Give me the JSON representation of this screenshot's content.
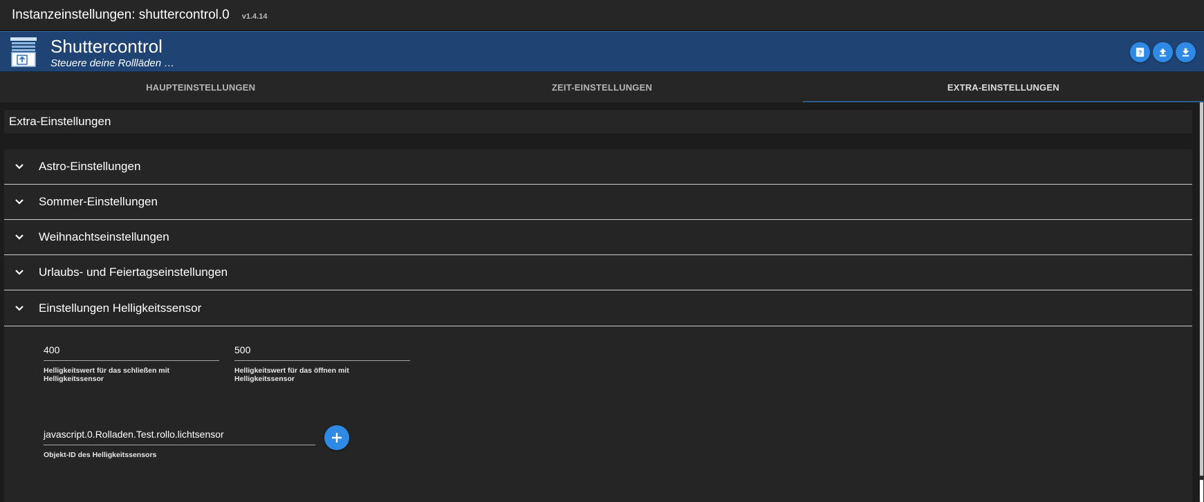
{
  "window": {
    "title": "Instanzeinstellungen: shuttercontrol.0",
    "version": "v1.4.14"
  },
  "header": {
    "app_name": "Shuttercontrol",
    "app_desc": "Steuere deine Rollläden …",
    "buttons": [
      "help-icon",
      "upload-icon",
      "download-icon"
    ],
    "accent": "#1f4474"
  },
  "tabs": [
    {
      "label": "HAUPTEINSTELLUNGEN",
      "active": false
    },
    {
      "label": "ZEIT-EINSTELLUNGEN",
      "active": false
    },
    {
      "label": "EXTRA-EINSTELLUNGEN",
      "active": true
    }
  ],
  "section": {
    "title": "Extra-Einstellungen"
  },
  "accordion": [
    {
      "label": "Astro-Einstellungen",
      "expanded": false
    },
    {
      "label": "Sommer-Einstellungen",
      "expanded": false
    },
    {
      "label": "Weihnachtseinstellungen",
      "expanded": false
    },
    {
      "label": "Urlaubs- und Feiertagseinstellungen",
      "expanded": false
    },
    {
      "label": "Einstellungen Helligkeitssensor",
      "expanded": true
    }
  ],
  "brightness": {
    "close_value": "400",
    "close_hint": "Helligkeitswert für das schließen mit Helligkeitssensor",
    "open_value": "500",
    "open_hint": "Helligkeitswert für das öffnen mit Helligkeitssensor",
    "object_id": "javascript.0.Rolladen.Test.rollo.lichtsensor",
    "object_hint": "Objekt-ID des Helligkeitssensors"
  },
  "colors": {
    "button_blue": "#2f8ae5",
    "background": "#1c1c1c"
  }
}
